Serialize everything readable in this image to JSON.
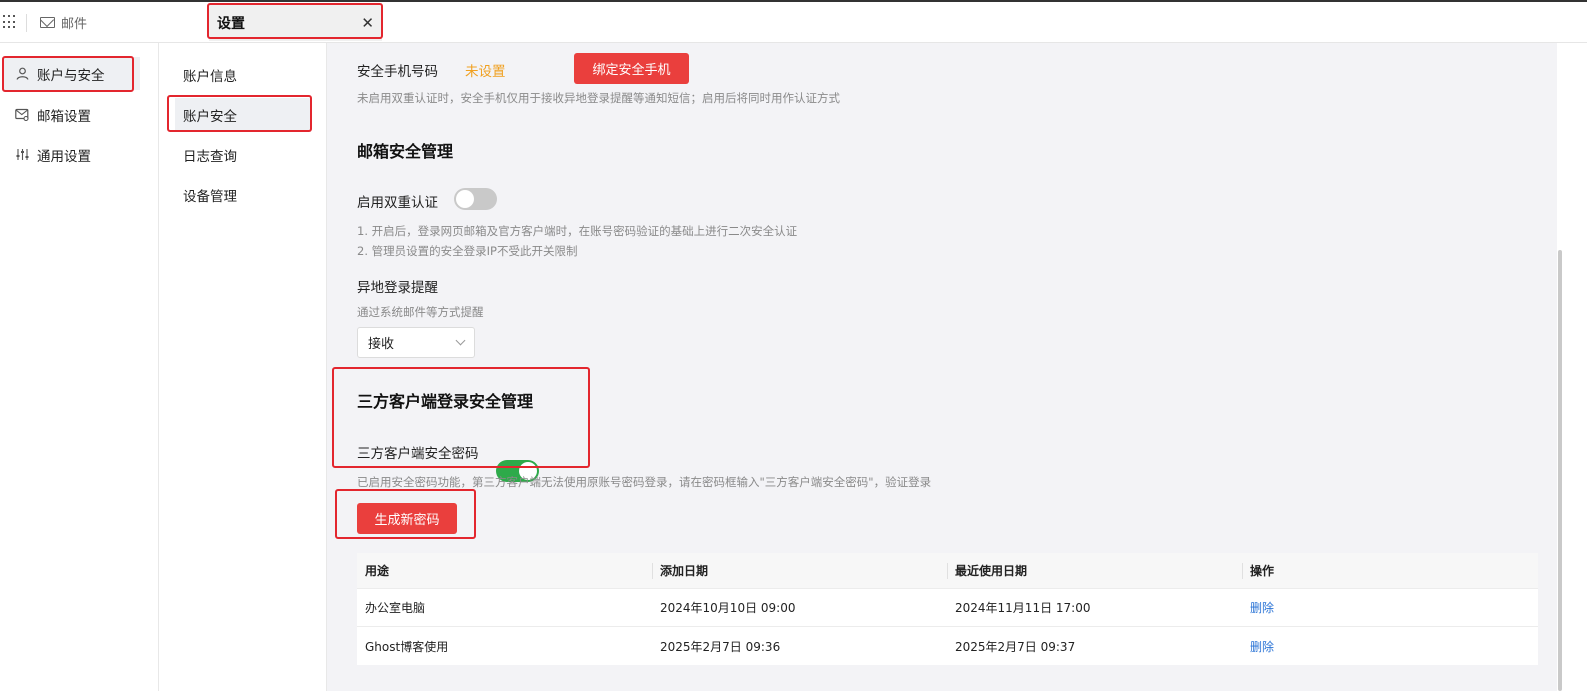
{
  "app": {
    "name": "邮件"
  },
  "tab": {
    "title": "设置",
    "close_glyph": "✕"
  },
  "sidebar_primary": [
    {
      "label": "账户与安全",
      "icon": "user-icon",
      "active": true
    },
    {
      "label": "邮箱设置",
      "icon": "mailbox-settings-icon",
      "active": false
    },
    {
      "label": "通用设置",
      "icon": "sliders-icon",
      "active": false
    }
  ],
  "sidebar_secondary": [
    {
      "label": "账户信息",
      "active": false
    },
    {
      "label": "账户安全",
      "active": true
    },
    {
      "label": "日志查询",
      "active": false
    },
    {
      "label": "设备管理",
      "active": false
    }
  ],
  "phone": {
    "label": "安全手机号码",
    "status": "未设置",
    "bind_button": "绑定安全手机",
    "hint": "未启用双重认证时，安全手机仅用于接收异地登录提醒等通知短信；启用后将同时用作认证方式"
  },
  "mailbox_security": {
    "title": "邮箱安全管理",
    "two_factor_label": "启用双重认证",
    "two_factor_enabled": false,
    "notes": [
      "1. 开启后，登录网页邮箱及官方客户端时，在账号密码验证的基础上进行二次安全认证",
      "2. 管理员设置的安全登录IP不受此开关限制"
    ],
    "remote_login_label": "异地登录提醒",
    "remote_login_hint": "通过系统邮件等方式提醒",
    "remote_login_value": "接收"
  },
  "third_party": {
    "title": "三方客户端登录安全管理",
    "password_label": "三方客户端安全密码",
    "password_enabled": true,
    "hint": "已启用安全密码功能，第三方客户端无法使用原账号密码登录，请在密码框输入\"三方客户端安全密码\"，验证登录",
    "generate_button": "生成新密码"
  },
  "table": {
    "columns": [
      "用途",
      "添加日期",
      "最近使用日期",
      "操作"
    ],
    "rows": [
      {
        "purpose": "办公室电脑",
        "added": "2024年10月10日 09:00",
        "last_used": "2024年11月11日 17:00",
        "action": "删除"
      },
      {
        "purpose": "Ghost博客使用",
        "added": "2025年2月7日 09:36",
        "last_used": "2025年2月7日 09:37",
        "action": "删除"
      }
    ]
  },
  "colors": {
    "accent_red": "#ea3f3d",
    "warning": "#f0a020",
    "switch_on": "#2eaa4a",
    "link": "#2b74d6",
    "highlight_box": "#e3262e"
  }
}
